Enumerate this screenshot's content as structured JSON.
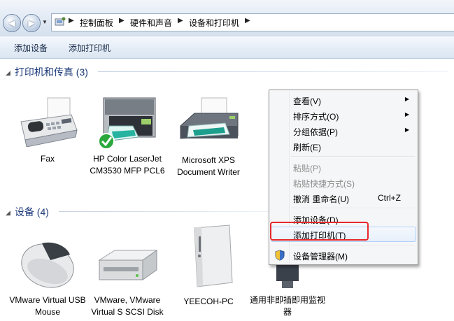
{
  "breadcrumb": {
    "items": [
      "控制面板",
      "硬件和声音",
      "设备和打印机"
    ]
  },
  "toolbar": {
    "add_device": "添加设备",
    "add_printer": "添加打印机"
  },
  "groups": {
    "printers": {
      "title": "打印机和传真 (3)",
      "items": [
        {
          "label": "Fax",
          "icon": "fax-icon"
        },
        {
          "label": "HP Color LaserJet CM3530 MFP PCL6",
          "icon": "printer-default-icon"
        },
        {
          "label": "Microsoft XPS Document Writer",
          "icon": "printer-icon"
        }
      ]
    },
    "devices": {
      "title": "设备 (4)",
      "items": [
        {
          "label": "VMware Virtual USB Mouse",
          "icon": "mouse-icon"
        },
        {
          "label": "VMware, VMware Virtual S SCSI Disk",
          "icon": "disk-icon"
        },
        {
          "label": "YEECOH-PC",
          "icon": "computer-icon"
        },
        {
          "label": "通用非即插即用监视器",
          "icon": "monitor-icon"
        }
      ]
    }
  },
  "context_menu": {
    "view": "查看(V)",
    "sort": "排序方式(O)",
    "group": "分组依据(P)",
    "refresh": "刷新(E)",
    "paste": "粘贴(P)",
    "paste_shortcut": "粘贴快捷方式(S)",
    "undo_rename": "撤消 重命名(U)",
    "undo_shortcut": "Ctrl+Z",
    "add_device": "添加设备(D)",
    "add_printer": "添加打印机(T)",
    "device_manager": "设备管理器(M)"
  },
  "colors": {
    "highlight_border": "#e8282a",
    "group_header": "#1e3b7a"
  }
}
